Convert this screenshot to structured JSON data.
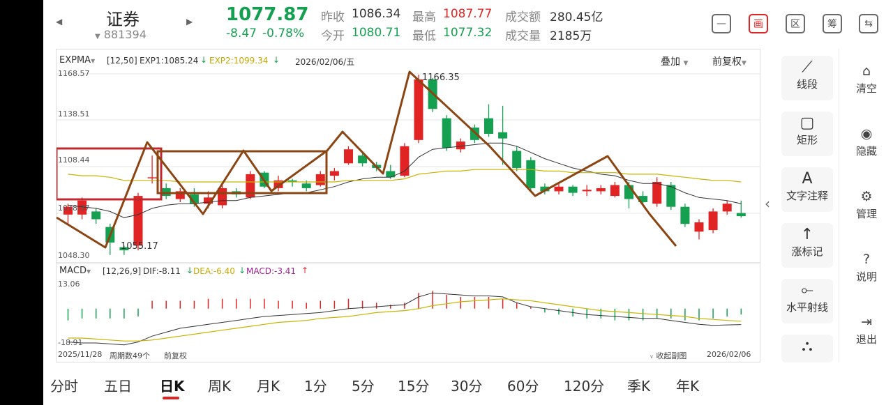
{
  "header": {
    "stock_name": "证券",
    "stock_code": "881394",
    "price": "1077.87",
    "change": "-8.47",
    "change_pct": "-0.78%",
    "stats": [
      {
        "label": "昨收",
        "value": "1086.34",
        "color": "dark"
      },
      {
        "label": "最高",
        "value": "1087.77",
        "color": "red"
      },
      {
        "label": "成交额",
        "value": "280.45亿",
        "color": "dark"
      },
      {
        "label": "今开",
        "value": "1080.71",
        "color": "green"
      },
      {
        "label": "最低",
        "value": "1077.32",
        "color": "green"
      },
      {
        "label": "成交量",
        "value": "2185万",
        "color": "dark"
      }
    ],
    "top_icons": [
      {
        "name": "minimize-icon",
        "glyph": "—"
      },
      {
        "name": "draw-icon",
        "glyph": "画"
      },
      {
        "name": "range-icon",
        "glyph": "区"
      },
      {
        "name": "chips-icon",
        "glyph": "筹"
      },
      {
        "name": "rotate-device-icon",
        "glyph": "⇆"
      }
    ]
  },
  "main_chart": {
    "indicator": "EXPMA",
    "params": "[12,50]",
    "exp1": "EXP1:1085.24",
    "exp2": "EXP2:1099.34",
    "date": "2026/02/06/五",
    "overlay": "叠加",
    "adjust": "前复权",
    "y_ticks": [
      "1168.57",
      "1138.51",
      "1108.44",
      "1078.37",
      "1048.30"
    ],
    "high_label": "1166.35",
    "low_label": "1055.17"
  },
  "macd": {
    "indicator": "MACD",
    "params": "[12,26,9]",
    "dif": "DIF:-8.11",
    "dea": "DEA:-6.40",
    "macd": "MACD:-3.41",
    "y_max": "13.06",
    "y_min": "-18.91"
  },
  "footer_info": {
    "start_date": "2025/11/28",
    "period": "周期数49个",
    "adjust": "前复权",
    "collapse": "收起副图",
    "end_date": "2026/02/06"
  },
  "tools": [
    {
      "name": "tool-segment",
      "icon": "segment-icon",
      "glyph": "⟋",
      "label": "线段"
    },
    {
      "name": "tool-rectangle",
      "icon": "rectangle-icon",
      "glyph": "▢",
      "label": "矩形"
    },
    {
      "name": "tool-text",
      "icon": "text-icon",
      "glyph": "A",
      "label": "文字注释"
    },
    {
      "name": "tool-up-mark",
      "icon": "arrow-up-icon",
      "glyph": "↑",
      "label": "涨标记"
    },
    {
      "name": "tool-horizontal-ray",
      "icon": "ray-icon",
      "glyph": "⟜",
      "label": "水平射线"
    },
    {
      "name": "tool-more",
      "icon": "more-tools-icon",
      "glyph": "⛬",
      "label": ""
    }
  ],
  "right_panel": [
    {
      "name": "clear",
      "icon": "clear-icon",
      "glyph": "⌂",
      "label": "清空"
    },
    {
      "name": "hide",
      "icon": "eye-icon",
      "glyph": "◉",
      "label": "隐藏"
    },
    {
      "name": "manage",
      "icon": "manage-icon",
      "glyph": "⚙",
      "label": "管理"
    },
    {
      "name": "help",
      "icon": "help-icon",
      "glyph": "?",
      "label": "说明"
    },
    {
      "name": "exit",
      "icon": "exit-icon",
      "glyph": "⇥",
      "label": "退出"
    }
  ],
  "tabs": [
    "分时",
    "五日",
    "日K",
    "周K",
    "月K",
    "1分",
    "5分",
    "15分",
    "30分",
    "60分",
    "120分",
    "季K",
    "年K"
  ],
  "active_tab": "日K",
  "colors": {
    "up": "#e02424",
    "down": "#14a050",
    "accent": "#e02424",
    "drawing": "#8b4513",
    "exp1": "#333333",
    "exp2": "#c8b400"
  },
  "chart_data": [
    {
      "type": "candlestick",
      "ylim": [
        1048.3,
        1168.57
      ],
      "ohlc": [
        [
          1078,
          1083,
          1072,
          1085
        ],
        [
          1078,
          1087,
          1075,
          1089
        ],
        [
          1080,
          1075,
          1072,
          1082
        ],
        [
          1070,
          1060,
          1052,
          1072
        ],
        [
          1057,
          1055,
          1052,
          1058
        ],
        [
          1058,
          1090,
          1055,
          1092
        ],
        [
          1102,
          1102,
          1098,
          1116
        ],
        [
          1095,
          1090,
          1088,
          1098
        ],
        [
          1088,
          1093,
          1086,
          1095
        ],
        [
          1091,
          1085,
          1083,
          1095
        ],
        [
          1085,
          1089,
          1082,
          1093
        ],
        [
          1084,
          1095,
          1082,
          1097
        ],
        [
          1093,
          1091,
          1089,
          1095
        ],
        [
          1089,
          1104,
          1088,
          1106
        ],
        [
          1105,
          1096,
          1095,
          1106
        ],
        [
          1095,
          1100,
          1093,
          1103
        ],
        [
          1100,
          1099,
          1096,
          1101
        ],
        [
          1098,
          1095,
          1093,
          1100
        ],
        [
          1097,
          1104,
          1096,
          1106
        ],
        [
          1103,
          1106,
          1100,
          1108
        ],
        [
          1111,
          1120,
          1110,
          1122
        ],
        [
          1116,
          1111,
          1109,
          1118
        ],
        [
          1110,
          1108,
          1106,
          1112
        ],
        [
          1106,
          1102,
          1101,
          1110
        ],
        [
          1103,
          1122,
          1102,
          1124
        ],
        [
          1126,
          1165,
          1124,
          1168
        ],
        [
          1165,
          1146,
          1144,
          1166
        ],
        [
          1140,
          1121,
          1119,
          1142
        ],
        [
          1120,
          1125,
          1118,
          1127
        ],
        [
          1134,
          1126,
          1124,
          1136
        ],
        [
          1140,
          1130,
          1128,
          1149
        ],
        [
          1131,
          1127,
          1110,
          1148
        ],
        [
          1119,
          1108,
          1106,
          1122
        ],
        [
          1113,
          1095,
          1093,
          1115
        ],
        [
          1096,
          1093,
          1091,
          1098
        ],
        [
          1093,
          1096,
          1091,
          1098
        ],
        [
          1096,
          1092,
          1090,
          1097
        ],
        [
          1093,
          1094,
          1090,
          1097
        ],
        [
          1093,
          1095,
          1091,
          1097
        ],
        [
          1090,
          1097,
          1089,
          1099
        ],
        [
          1097,
          1088,
          1082,
          1099
        ],
        [
          1090,
          1086,
          1084,
          1093
        ],
        [
          1085,
          1099,
          1083,
          1102
        ],
        [
          1097,
          1083,
          1081,
          1099
        ],
        [
          1083,
          1072,
          1070,
          1085
        ],
        [
          1067,
          1073,
          1062,
          1075
        ],
        [
          1068,
          1080,
          1066,
          1082
        ],
        [
          1080,
          1085,
          1078,
          1087
        ],
        [
          1079,
          1077,
          1076,
          1087
        ]
      ],
      "exp1": [
        1084,
        1083,
        1082,
        1080,
        1076,
        1078,
        1082,
        1084,
        1085,
        1085,
        1086,
        1087,
        1087,
        1089,
        1090,
        1091,
        1092,
        1092,
        1094,
        1096,
        1099,
        1101,
        1102,
        1102,
        1106,
        1115,
        1120,
        1121,
        1122,
        1123,
        1124,
        1124,
        1122,
        1118,
        1114,
        1111,
        1108,
        1106,
        1104,
        1103,
        1100,
        1098,
        1098,
        1096,
        1092,
        1089,
        1088,
        1087,
        1085
      ],
      "exp2": [
        1104,
        1103,
        1103,
        1102,
        1100,
        1100,
        1100,
        1100,
        1099,
        1099,
        1099,
        1099,
        1099,
        1099,
        1099,
        1099,
        1099,
        1099,
        1099,
        1099,
        1100,
        1100,
        1100,
        1100,
        1101,
        1104,
        1105,
        1106,
        1106,
        1107,
        1107,
        1107,
        1107,
        1107,
        1106,
        1106,
        1105,
        1105,
        1105,
        1105,
        1104,
        1104,
        1104,
        1103,
        1102,
        1101,
        1100,
        1100,
        1099
      ]
    },
    {
      "type": "bar",
      "ylim": [
        -18.91,
        13.06
      ],
      "macd_hist": [
        -6,
        -5,
        -5,
        -5,
        -5,
        -4,
        4,
        4,
        4,
        4,
        5,
        5,
        5,
        5,
        5,
        4,
        4,
        3,
        4,
        4,
        5,
        4,
        3,
        2,
        3,
        8,
        9,
        7,
        6,
        6,
        6,
        5,
        3,
        1,
        -2,
        -3,
        -4,
        -5,
        -5,
        -6,
        -6,
        -6,
        -5,
        -5,
        -6,
        -6,
        -5,
        -4,
        -3
      ],
      "dif": [
        -17,
        -17.5,
        -17.5,
        -18,
        -18.5,
        -17,
        -14,
        -12,
        -10,
        -9,
        -8,
        -7,
        -6,
        -5,
        -4,
        -3.5,
        -3,
        -2.5,
        -2,
        -1,
        0,
        0.5,
        1,
        1.5,
        2,
        6,
        8,
        7.5,
        7,
        6.5,
        6.5,
        6,
        3,
        1,
        0,
        -1,
        -2,
        -3,
        -3.5,
        -4,
        -4.5,
        -5,
        -5,
        -6,
        -7,
        -8,
        -8.5,
        -8.3,
        -8.1
      ],
      "dea": [
        -15,
        -15,
        -15.5,
        -16,
        -16.5,
        -16.5,
        -16,
        -15,
        -14,
        -13,
        -12,
        -11,
        -10,
        -9,
        -8,
        -7,
        -6.5,
        -6,
        -5,
        -4.5,
        -4,
        -3,
        -2,
        -1.5,
        -1,
        0,
        1.5,
        2.5,
        3.5,
        4,
        4.5,
        5,
        4.5,
        4,
        3,
        2,
        1,
        0,
        -1,
        -1.5,
        -2,
        -2.5,
        -3,
        -3.5,
        -4,
        -5,
        -5.5,
        -6,
        -6.4
      ]
    }
  ]
}
